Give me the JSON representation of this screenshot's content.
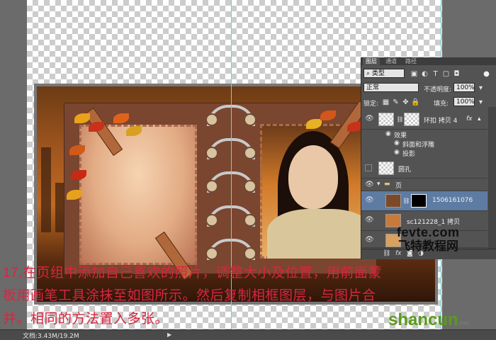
{
  "layers_panel": {
    "tabs": [
      "图层",
      "通道",
      "路径"
    ],
    "filter_kind": "类型",
    "blend_mode": "正常",
    "opacity_label": "不透明度:",
    "opacity_value": "100%",
    "lock_label": "锁定:",
    "fill_label": "填充:",
    "fill_value": "100%",
    "layers": [
      {
        "name": "环扣 拷贝 4",
        "fx": "fx",
        "visible": true
      },
      {
        "name": "效果",
        "kind": "effects-header"
      },
      {
        "name": "斜面和浮雕",
        "kind": "effect"
      },
      {
        "name": "投影",
        "kind": "effect"
      },
      {
        "name": "圆孔",
        "visible": false
      },
      {
        "name": "页",
        "kind": "group",
        "visible": true
      },
      {
        "name": "1506161076",
        "selected": true,
        "visible": true
      },
      {
        "name": "sc121228_1 拷贝",
        "visible": true
      },
      {
        "name": "fevte.com",
        "visible": true
      }
    ]
  },
  "status_bar": {
    "doc_info": "文档:3.43M/19.2M"
  },
  "caption": {
    "line1": "17.在页组中添加自己喜欢的照片，调整大小及位置，用前面蒙",
    "line2": "板用画笔工具涂抹至如图所示。然后复制相框图层，与图片合",
    "line3": "并。相同的方法置入多张。"
  },
  "watermarks": {
    "site1": "fevte.com",
    "site1_cn": "飞特教程网",
    "site2": "shancun",
    "site2_suffix": ".net"
  },
  "colors": {
    "caption_red": "#d8263f",
    "selection_blue": "#5e7ca3",
    "guide_cyan": "#45e6e6"
  }
}
